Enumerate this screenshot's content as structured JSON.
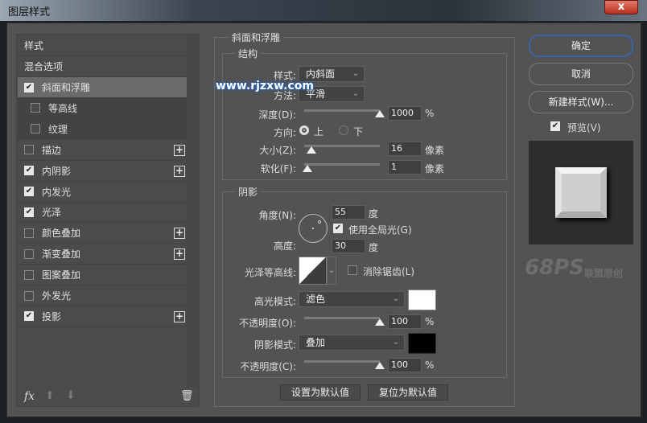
{
  "window": {
    "title": "图层样式",
    "close": "x"
  },
  "styles_list": {
    "header": "样式",
    "blend": "混合选项",
    "items": [
      {
        "label": "斜面和浮雕",
        "checked": true,
        "selected": true,
        "plus": false
      },
      {
        "label": "等高线",
        "checked": false,
        "sub": true
      },
      {
        "label": "纹理",
        "checked": false,
        "sub": true
      },
      {
        "label": "描边",
        "checked": false,
        "plus": true
      },
      {
        "label": "内阴影",
        "checked": true,
        "plus": true
      },
      {
        "label": "内发光",
        "checked": true,
        "plus": false
      },
      {
        "label": "光泽",
        "checked": true,
        "plus": false
      },
      {
        "label": "颜色叠加",
        "checked": false,
        "plus": true
      },
      {
        "label": "渐变叠加",
        "checked": false,
        "plus": true
      },
      {
        "label": "图案叠加",
        "checked": false,
        "plus": false
      },
      {
        "label": "外发光",
        "checked": false,
        "plus": false
      },
      {
        "label": "投影",
        "checked": true,
        "plus": true
      }
    ],
    "fx": "fx"
  },
  "bevel": {
    "title": "斜面和浮雕",
    "structure": {
      "title": "结构",
      "style_label": "样式:",
      "style_value": "内斜面",
      "method_label": "方法:",
      "method_value": "平滑",
      "depth_label": "深度(D):",
      "depth_value": "1000",
      "depth_unit": "%",
      "depth_fraction": 1.0,
      "direction_label": "方向:",
      "dir_up": "上",
      "dir_down": "下",
      "direction": "up",
      "size_label": "大小(Z):",
      "size_value": "16",
      "size_unit": "像素",
      "size_fraction": 0.06,
      "soften_label": "软化(F):",
      "soften_value": "1",
      "soften_unit": "像素",
      "soften_fraction": 0.0
    },
    "shading": {
      "title": "阴影",
      "angle_label": "角度(N):",
      "angle_value": "55",
      "angle_unit": "度",
      "global_light": "使用全局光(G)",
      "global_light_checked": true,
      "altitude_label": "高度:",
      "altitude_value": "30",
      "altitude_unit": "度",
      "gloss_label": "光泽等高线:",
      "antialias": "消除锯齿(L)",
      "antialias_checked": false,
      "highlight_label": "高光模式:",
      "highlight_value": "滤色",
      "highlight_color": "#ffffff",
      "hl_opacity_label": "不透明度(O):",
      "hl_opacity_value": "100",
      "hl_opacity_unit": "%",
      "shadow_label": "阴影模式:",
      "shadow_value": "叠加",
      "shadow_color": "#000000",
      "sh_opacity_label": "不透明度(C):",
      "sh_opacity_value": "100",
      "sh_opacity_unit": "%"
    },
    "make_default": "设置为默认值",
    "reset_default": "复位为默认值"
  },
  "right": {
    "ok": "确定",
    "cancel": "取消",
    "new_style": "新建样式(W)...",
    "preview": "预览(V)",
    "preview_checked": true
  },
  "watermarks": {
    "top": "www.rjzxw.com",
    "bottom_logo": "68PS",
    "bottom_text": "联盟原创"
  }
}
